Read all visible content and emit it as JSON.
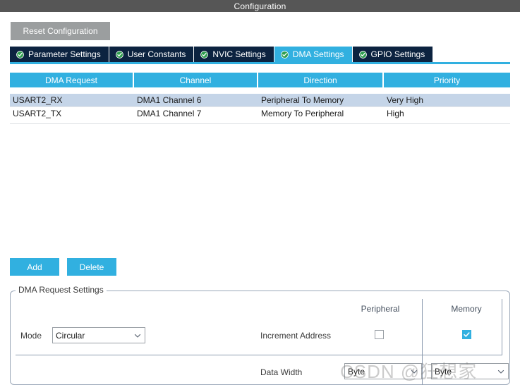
{
  "window": {
    "title": "Configuration"
  },
  "toolbar": {
    "reset_label": "Reset Configuration"
  },
  "tabs": [
    {
      "label": "Parameter Settings",
      "icon": "green-check-icon",
      "active": false
    },
    {
      "label": "User Constants",
      "icon": "green-check-icon",
      "active": false
    },
    {
      "label": "NVIC Settings",
      "icon": "green-check-icon",
      "active": false
    },
    {
      "label": "DMA Settings",
      "icon": "green-check-icon",
      "active": true
    },
    {
      "label": "GPIO Settings",
      "icon": "green-check-icon",
      "active": false
    }
  ],
  "table": {
    "headers": [
      "DMA Request",
      "Channel",
      "Direction",
      "Priority"
    ],
    "rows": [
      {
        "selected": true,
        "cells": [
          "USART2_RX",
          "DMA1 Channel 6",
          "Peripheral To Memory",
          "Very High"
        ]
      },
      {
        "selected": false,
        "cells": [
          "USART2_TX",
          "DMA1 Channel 7",
          "Memory To Peripheral",
          "High"
        ]
      }
    ]
  },
  "actions": {
    "add_label": "Add",
    "delete_label": "Delete"
  },
  "settings": {
    "group_title": "DMA Request Settings",
    "col_peripheral": "Peripheral",
    "col_memory": "Memory",
    "mode_label": "Mode",
    "mode_value": "Circular",
    "increment_label": "Increment Address",
    "increment_peripheral_checked": false,
    "increment_memory_checked": true,
    "data_width_label": "Data Width",
    "data_width_peripheral": "Byte",
    "data_width_memory": "Byte"
  },
  "watermark": {
    "text": "CSDN @狂想家"
  },
  "colors": {
    "titlebar": "#565656",
    "accent": "#31b0e0",
    "tab_inactive": "#0c2340",
    "selection": "#c5d5e8",
    "reset_button": "#9b9e9f"
  }
}
